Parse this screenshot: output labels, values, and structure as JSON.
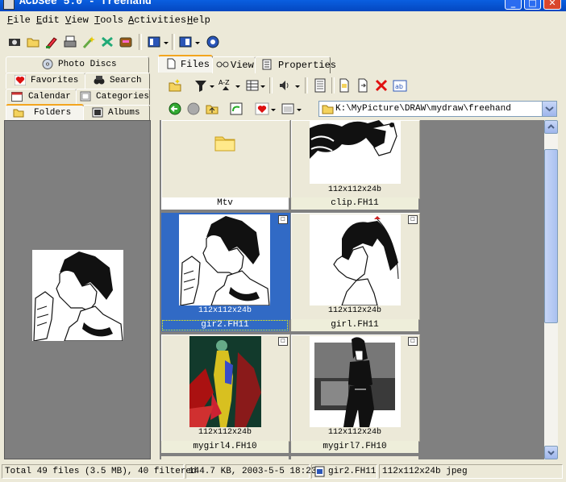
{
  "window": {
    "title": "ACDSee 5.0 - freehand",
    "buttons": {
      "minimize": "_",
      "maximize": "□",
      "close": "✕"
    }
  },
  "menu": [
    "File",
    "Edit",
    "View",
    "Tools",
    "Activities",
    "Help"
  ],
  "menu_underline": [
    "F",
    "E",
    "V",
    "T",
    "A",
    "H"
  ],
  "left_tabs": {
    "photo_discs": "Photo Discs",
    "favorites": "Favorites",
    "search": "Search",
    "calendar": "Calendar",
    "categories": "Categories",
    "folders": "Folders",
    "albums": "Albums"
  },
  "right_tabs": {
    "files": "Files",
    "view": "View",
    "properties": "Properties"
  },
  "address": {
    "path": "K:\\MyPicture\\DRAW\\mydraw\\freehand"
  },
  "files": [
    {
      "name": "Mtv",
      "dims": "",
      "type": "folder"
    },
    {
      "name": "clip.FH11",
      "dims": "112x112x24b",
      "type": "image"
    },
    {
      "name": "gir2.FH11",
      "dims": "112x112x24b",
      "type": "image",
      "selected": true
    },
    {
      "name": "girl.FH11",
      "dims": "112x112x24b",
      "type": "image"
    },
    {
      "name": "mygirl4.FH10",
      "dims": "112x112x24b",
      "type": "image"
    },
    {
      "name": "mygirl7.FH10",
      "dims": "112x112x24b",
      "type": "image"
    }
  ],
  "status": {
    "total": "Total 49 files (3.5 MB), 40 filtered",
    "selected_info": "144.7 KB, 2003-5-5 18:23",
    "selected_name": "gir2.FH11",
    "selected_format": "112x112x24b jpeg"
  },
  "colors": {
    "titlebar": "#0a5fe0",
    "selection": "#316ac5",
    "pane_gray": "#7f7f7f",
    "window_bg": "#ece9d8"
  }
}
